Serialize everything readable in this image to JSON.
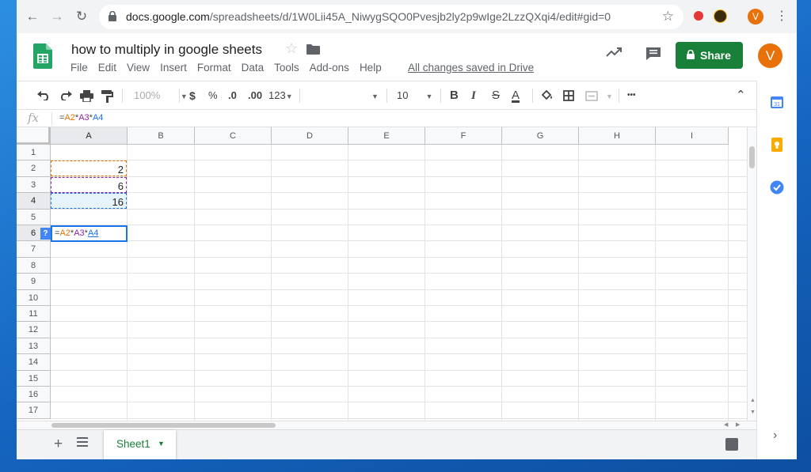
{
  "browser": {
    "url_host": "docs.google.com",
    "url_path": "/spreadsheets/d/1W0Lii45A_NiwygSQO0Pvesjb2ly2p9wIge2LzzQXqi4/edit#gid=0",
    "avatar_letter": "V"
  },
  "app": {
    "doc_title": "how to multiply in google sheets",
    "menu": [
      "File",
      "Edit",
      "View",
      "Insert",
      "Format",
      "Data",
      "Tools",
      "Add-ons",
      "Help"
    ],
    "save_status": "All changes saved in Drive",
    "share_label": "Share",
    "avatar_letter": "V",
    "brand_color": "#188038"
  },
  "toolbar": {
    "zoom": "100%",
    "currency": "$",
    "percent": "%",
    "decrease_decimals": ".0",
    "increase_decimals": ".00",
    "number_format": "123",
    "font_size": "10",
    "bold": "B",
    "italic": "I",
    "strikethrough": "S",
    "text_color": "A",
    "more": "•••"
  },
  "formula_bar": {
    "fx_label": "fx",
    "parts": [
      "=",
      "A2",
      "*",
      "A3",
      "*",
      "A4"
    ]
  },
  "grid": {
    "columns": [
      "A",
      "B",
      "C",
      "D",
      "E",
      "F",
      "G",
      "H",
      "I"
    ],
    "rows": [
      "1",
      "2",
      "3",
      "4",
      "5",
      "6",
      "7",
      "8",
      "9",
      "10",
      "11",
      "12",
      "13",
      "14",
      "15",
      "16",
      "17"
    ],
    "cells": {
      "A2": "2",
      "A3": "6",
      "A4": "16"
    },
    "active_cell": "A6",
    "active_help_badge": "?",
    "editing_parts": [
      "=",
      "A2",
      "*",
      "A3",
      "*",
      "A4"
    ]
  },
  "sheets": {
    "tabs": [
      "Sheet1"
    ],
    "add_label": "+"
  }
}
